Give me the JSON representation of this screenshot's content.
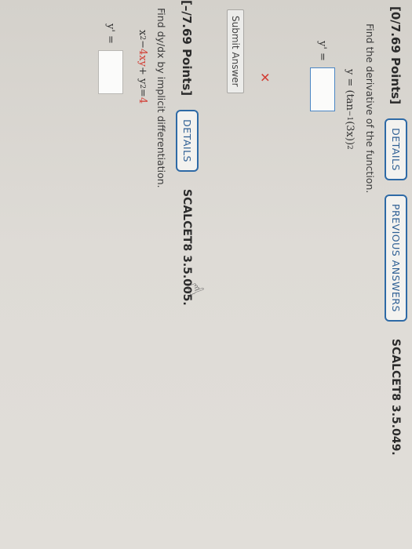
{
  "q1": {
    "points": "[0/7.69 Points]",
    "details": "DETAILS",
    "previous_answers": "PREVIOUS ANSWERS",
    "code": "SCALCET8 3.5.049.",
    "prompt": "Find the derivative of the function.",
    "equation_prefix": "y = (tan",
    "equation_sup": "−1",
    "equation_mid": "(3x))",
    "equation_power": "2",
    "answer_label": "y' =",
    "answer_value": "",
    "status_icon": "x-mark",
    "submit": "Submit Answer"
  },
  "q2": {
    "points": "[–/7.69 Points]",
    "details": "DETAILS",
    "code": "SCALCET8 3.5.005.",
    "prompt": "Find dy/dx by implicit differentiation.",
    "eq_x": "x",
    "eq_x_pow": "2",
    "eq_minus": " − ",
    "eq_rest_red": "4xy",
    "eq_plus": " + y",
    "eq_y_pow": "2",
    "eq_equals": " = ",
    "eq_rhs_red": "4",
    "answer_label": "y' =",
    "answer_value": ""
  },
  "colors": {
    "accent": "#2e6aa6",
    "error": "#d23b32"
  },
  "cursor_icon": "hand-cursor-icon"
}
